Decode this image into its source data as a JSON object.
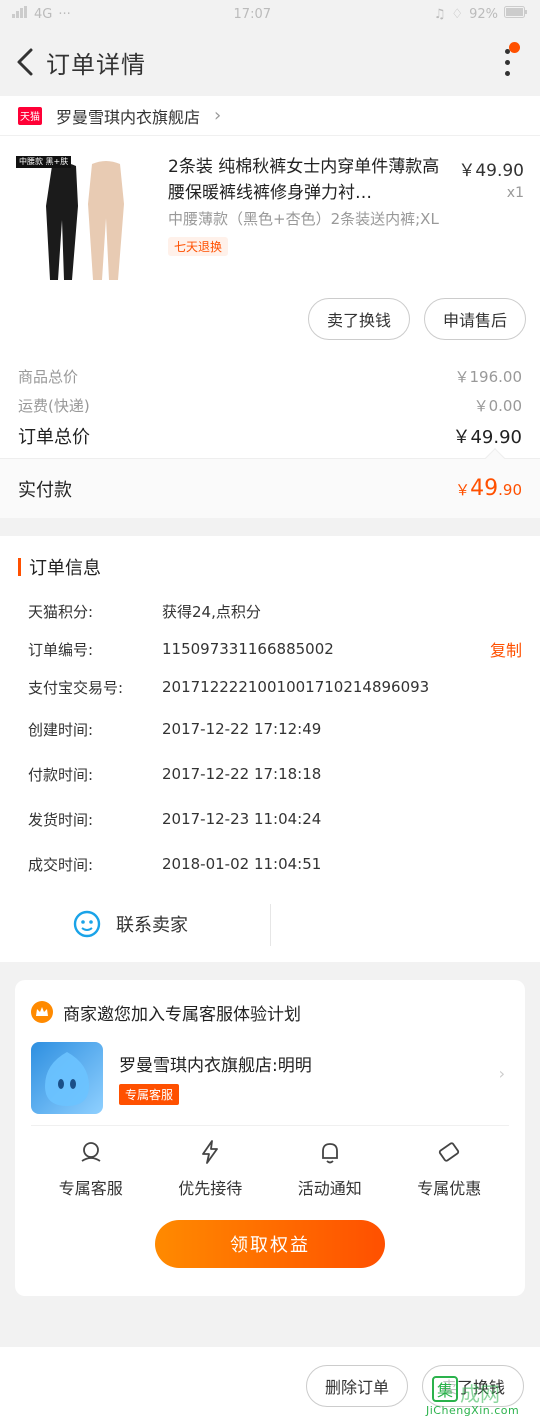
{
  "status_bar": {
    "signal": "4G",
    "time": "17:07",
    "battery": "92%"
  },
  "header": {
    "title": "订单详情"
  },
  "store": {
    "badge": "天猫",
    "name": "罗曼雪琪内衣旗舰店"
  },
  "product": {
    "image_tag": "中腰款 黑+肤",
    "title": "2条装 纯棉秋裤女士内穿单件薄款高腰保暖裤线裤修身弹力衬…",
    "sku": "中腰薄款（黑色+杏色）2条装送内裤;XL",
    "service_tag": "七天退换",
    "price": "￥49.90",
    "qty": "x1"
  },
  "item_actions": {
    "sell_label": "卖了换钱",
    "after_sale_label": "申请售后"
  },
  "summary": {
    "goods_total_label": "商品总价",
    "goods_total": "￥196.00",
    "shipping_label": "运费(快递)",
    "shipping": "￥0.00",
    "order_total_label": "订单总价",
    "order_total": "￥49.90",
    "paid_label": "实付款",
    "paid_currency": "￥",
    "paid_int": "49",
    "paid_dec": ".90"
  },
  "order_info": {
    "title": "订单信息",
    "rows": [
      {
        "k": "天猫积分:",
        "v": "获得24,点积分"
      },
      {
        "k": "订单编号:",
        "v": "115097331166885002",
        "action": "复制"
      },
      {
        "k": "支付宝交易号:",
        "v": "2017122221001001710214896093"
      },
      {
        "k": "创建时间:",
        "v": "2017-12-22 17:12:49"
      },
      {
        "k": "付款时间:",
        "v": "2017-12-22 17:18:18"
      },
      {
        "k": "发货时间:",
        "v": "2017-12-23 11:04:24"
      },
      {
        "k": "成交时间:",
        "v": "2018-01-02 11:04:51"
      }
    ],
    "contact_label": "联系卖家"
  },
  "vip": {
    "title": "商家邀您加入专属客服体验计划",
    "agent_name": "罗曼雪琪内衣旗舰店:明明",
    "agent_tag": "专属客服",
    "perks": [
      "专属客服",
      "优先接待",
      "活动通知",
      "专属优惠"
    ],
    "cta": "领取权益"
  },
  "bottom_bar": {
    "delete_label": "删除订单",
    "sell_label": "卖了换钱"
  },
  "watermark": {
    "logo": "集",
    "text": "成网",
    "url": "JiChengXin.com"
  },
  "colors": {
    "accent": "#ff5000",
    "tmall": "#ff0036",
    "bg": "#f2f2f2"
  }
}
